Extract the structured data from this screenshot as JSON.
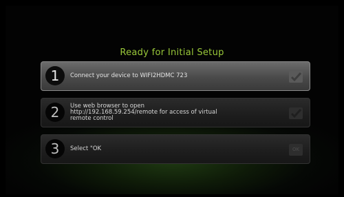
{
  "title": "Ready for Initial Setup",
  "steps": [
    {
      "number": "1",
      "text": "Connect your device to WIFI2HDMC 723",
      "status_icon": "check-icon"
    },
    {
      "number": "2",
      "text": "Use web browser to open\nhttp://192.168.59.254/remote for access of virtual\nremote control",
      "status_icon": "check-icon"
    },
    {
      "number": "3",
      "text": "Select \"OK",
      "status_icon": "ok-button",
      "ok_label": "OK"
    }
  ],
  "colors": {
    "title": "#9ac93a",
    "active_step": "#5a5a5a",
    "idle_step": "#1d1d1d"
  }
}
